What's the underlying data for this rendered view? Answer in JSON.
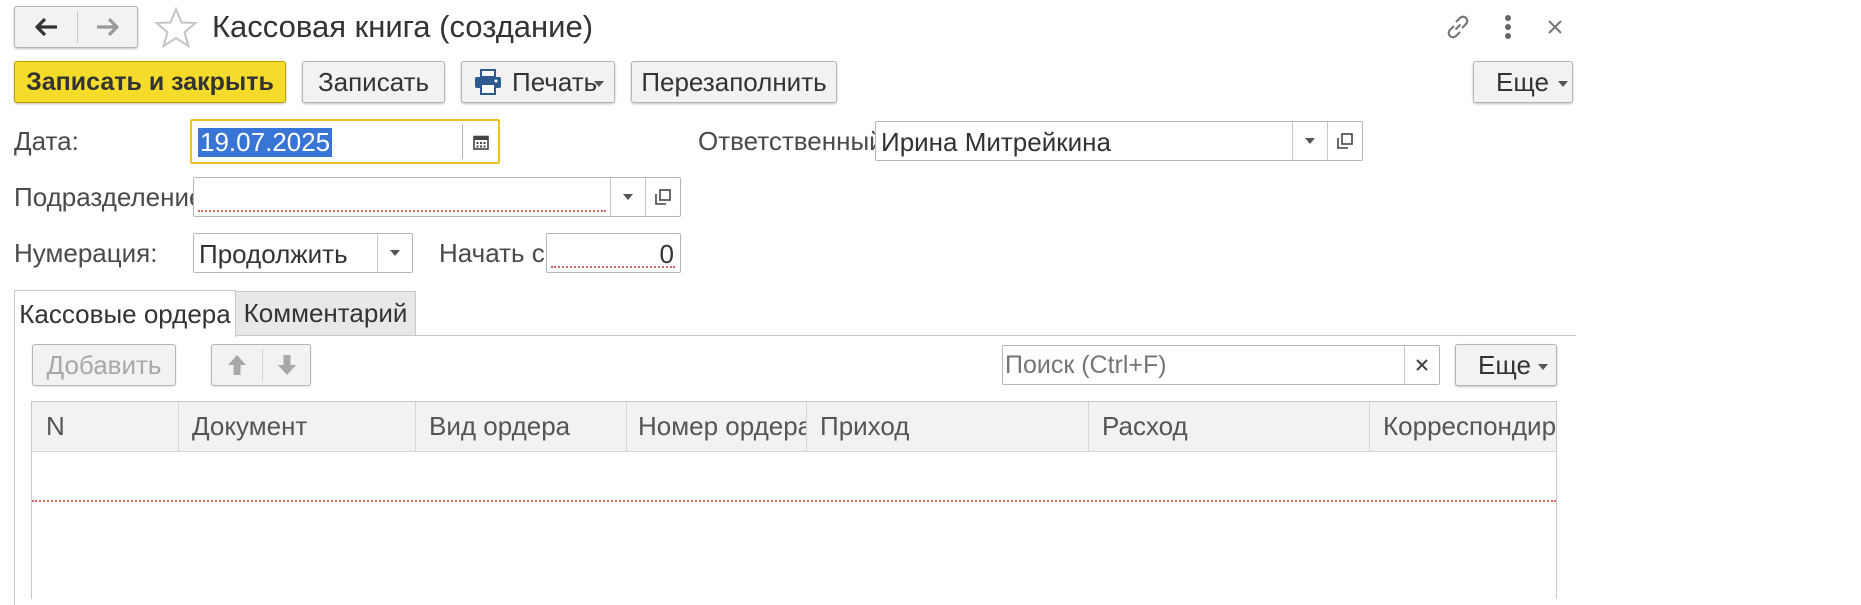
{
  "header": {
    "title": "Кассовая книга (создание)"
  },
  "toolbar": {
    "save_close_label": "Записать и закрыть",
    "save_label": "Записать",
    "print_label": "Печать",
    "refill_label": "Перезаполнить",
    "more_label": "Еще"
  },
  "form": {
    "date_label": "Дата:",
    "date_value": "19.07.2025",
    "responsible_label": "Ответственный:",
    "responsible_value": "Ирина Митрейкина",
    "division_label": "Подразделение:",
    "division_value": "",
    "numbering_label": "Нумерация:",
    "numbering_value": "Продолжить",
    "start_label": "Начать с:",
    "start_value": "0"
  },
  "tabs": [
    {
      "label": "Кассовые ордера",
      "active": true
    },
    {
      "label": "Комментарий",
      "active": false
    }
  ],
  "table_toolbar": {
    "add_label": "Добавить",
    "search_placeholder": "Поиск (Ctrl+F)",
    "more_label": "Еще"
  },
  "table": {
    "columns": [
      "N",
      "Документ",
      "Вид ордера",
      "Номер ордера",
      "Приход",
      "Расход",
      "Корреспондирук"
    ],
    "rows": []
  },
  "colors": {
    "primary_button": "#f5dc2a",
    "focus_border": "#f0c020",
    "selection": "#3875d7",
    "error_underline": "#e06060"
  }
}
